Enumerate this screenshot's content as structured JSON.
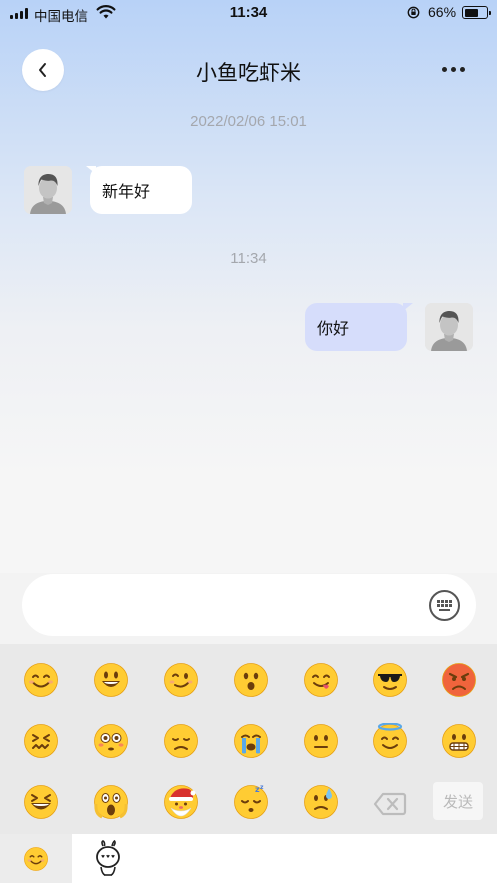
{
  "status_bar": {
    "carrier": "中国电信",
    "time": "11:34",
    "battery_percent": "66%",
    "battery_level": 0.66
  },
  "nav": {
    "title": "小鱼吃虾米",
    "back_icon": "chevron-left-icon",
    "more_icon": "more-horizontal-icon"
  },
  "messages": [
    {
      "type": "timestamp",
      "text": "2022/02/06 15:01"
    },
    {
      "type": "incoming",
      "text": "新年好",
      "avatar": "default-male-avatar"
    },
    {
      "type": "timestamp",
      "text": "11:34"
    },
    {
      "type": "outgoing",
      "text": "你好",
      "avatar": "default-male-avatar"
    }
  ],
  "input": {
    "value": "",
    "placeholder": "",
    "keyboard_icon": "keyboard-icon"
  },
  "emoji_panel": {
    "emojis": [
      "smile",
      "smiley",
      "wink",
      "astonished",
      "yum",
      "sunglasses",
      "angry",
      "confounded",
      "flushed",
      "disappointed",
      "sob",
      "neutral",
      "innocent",
      "grimacing",
      "laughing",
      "scream",
      "santa",
      "sleeping",
      "cold-sweat"
    ],
    "delete_icon": "backspace-icon",
    "send_label": "发送"
  },
  "tabs": [
    {
      "name": "emoji",
      "icon": "smile-emoji-icon",
      "selected": true
    },
    {
      "name": "sticker",
      "icon": "sticker-character-icon",
      "selected": false
    }
  ],
  "colors": {
    "header_gradient_top": "#b8d2f7",
    "outgoing_bubble": "#d6ddfb",
    "incoming_bubble": "#ffffff",
    "timestamp_text": "#a4a7ad",
    "send_button_text": "#b9b9b9"
  }
}
